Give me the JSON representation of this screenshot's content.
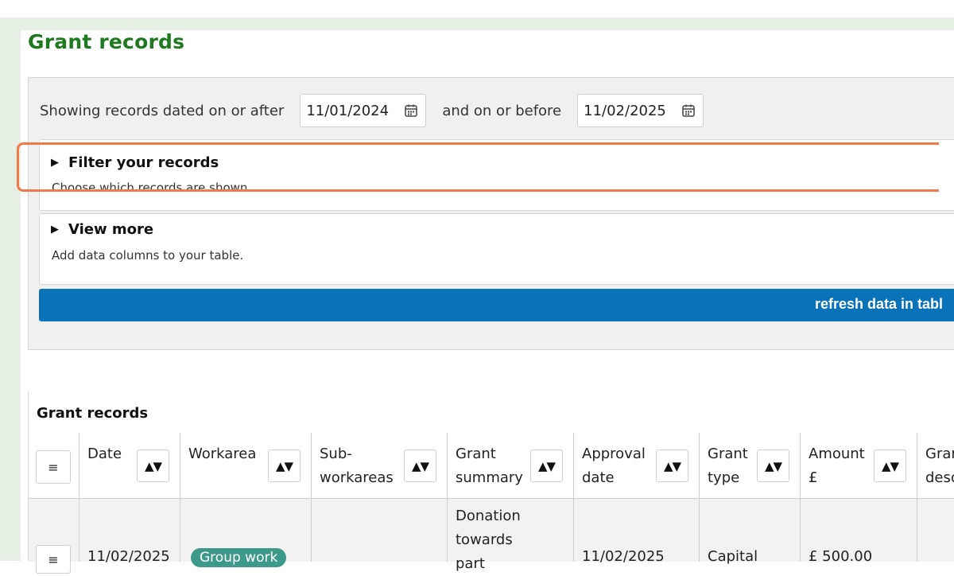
{
  "page": {
    "title": "Grant records"
  },
  "date_filter": {
    "prefix": "Showing records dated on or after",
    "start": "11/01/2024",
    "middle": "and on or before",
    "end": "11/02/2025"
  },
  "panels": {
    "filter": {
      "title": "Filter your records",
      "subtitle": "Choose which records are shown"
    },
    "view_more": {
      "title": "View more",
      "subtitle": "Add data columns to your table."
    }
  },
  "refresh_label": "refresh data in tabl",
  "table": {
    "caption": "Grant records",
    "menu_icon": "≡",
    "sort_icon": "▲▼",
    "columns": {
      "date": "Date",
      "workarea": "Workarea",
      "subworkareas_1": "Sub-",
      "subworkareas_2": "workareas",
      "summary_1": "Grant",
      "summary_2": "summary",
      "approval_1": "Approval",
      "approval_2": "date",
      "type_1": "Grant",
      "type_2": "type",
      "amount_1": "Amount",
      "amount_2": "£",
      "desc_1": "Gran",
      "desc_2": "desc"
    },
    "row": {
      "date": "11/02/2025",
      "workarea": "Group work",
      "summary_1": "Donation",
      "summary_2": "towards",
      "summary_3": "part",
      "approval": "11/02/2025",
      "type": "Capital",
      "amount": "£ 500.00"
    }
  },
  "colors": {
    "title_green": "#1f7a1f",
    "button_blue": "#0a72b8",
    "highlight": "#f07a4a",
    "badge_teal": "#3d9a8b"
  }
}
